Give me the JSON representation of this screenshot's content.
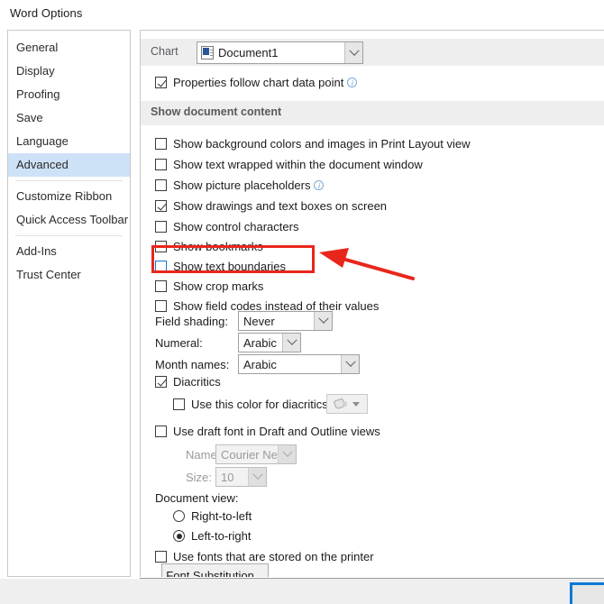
{
  "window": {
    "title": "Word Options"
  },
  "sidebar": {
    "items": [
      {
        "label": "General",
        "selected": false
      },
      {
        "label": "Display",
        "selected": false
      },
      {
        "label": "Proofing",
        "selected": false
      },
      {
        "label": "Save",
        "selected": false
      },
      {
        "label": "Language",
        "selected": false
      },
      {
        "label": "Advanced",
        "selected": true
      },
      {
        "label": "Customize Ribbon",
        "selected": false
      },
      {
        "label": "Quick Access Toolbar",
        "selected": false
      },
      {
        "label": "Add-Ins",
        "selected": false
      },
      {
        "label": "Trust Center",
        "selected": false
      }
    ],
    "selected_label": "Advanced"
  },
  "chart_group": {
    "label": "Chart",
    "document_combo": {
      "value": "Document1",
      "icon": "word-document-icon",
      "chevron": "chevron-down-icon"
    },
    "properties_follow": {
      "label": "Properties follow chart data point",
      "checked": true,
      "info_icon": "info-icon"
    }
  },
  "show_document_content": {
    "section_title": "Show document content",
    "checkboxes": [
      {
        "label": "Show background colors and images in Print Layout view",
        "checked": false,
        "info": false
      },
      {
        "label": "Show text wrapped within the document window",
        "checked": false,
        "info": false
      },
      {
        "label": "Show picture placeholders",
        "checked": false,
        "info": true
      },
      {
        "label": "Show drawings and text boxes on screen",
        "checked": true,
        "info": false
      },
      {
        "label": "Show control characters",
        "checked": false,
        "info": false
      },
      {
        "label": "Show bookmarks",
        "checked": false,
        "info": false
      },
      {
        "label": "Show text boundaries",
        "checked": false,
        "info": false,
        "focused": true,
        "highlighted": true
      },
      {
        "label": "Show crop marks",
        "checked": false,
        "info": false
      },
      {
        "label": "Show field codes instead of their values",
        "checked": false,
        "info": false
      }
    ],
    "field_shading": {
      "label": "Field shading:",
      "value": "Never"
    },
    "numeral": {
      "label": "Numeral:",
      "value": "Arabic"
    },
    "month_names": {
      "label": "Month names:",
      "value": "Arabic"
    },
    "diacritics": {
      "label": "Diacritics",
      "checked": true
    },
    "use_color_for_diacritics": {
      "label": "Use this color for diacritics",
      "checked": false,
      "button_icon": "fill-color-icon",
      "enabled": false
    },
    "use_draft_font": {
      "label": "Use draft font in Draft and Outline views",
      "checked": false
    },
    "draft_name": {
      "label": "Name:",
      "value": "Courier New",
      "enabled": false
    },
    "draft_size": {
      "label": "Size:",
      "value": "10",
      "enabled": false
    },
    "document_view": {
      "label": "Document view:",
      "options": [
        {
          "label": "Right-to-left",
          "selected": false
        },
        {
          "label": "Left-to-right",
          "selected": true
        }
      ]
    },
    "use_printer_fonts": {
      "label": "Use fonts that are stored on the printer",
      "checked": false
    },
    "font_substitution_button": "Font Substitution..."
  },
  "annotation": {
    "highlight_target": "Show text boundaries",
    "rect_color": "#e8261c",
    "arrow_color": "#e8261c"
  },
  "colors": {
    "accent": "#0a7ad4",
    "selection": "#cde2f7",
    "band": "#eeeeee",
    "annotation": "#e8261c"
  }
}
